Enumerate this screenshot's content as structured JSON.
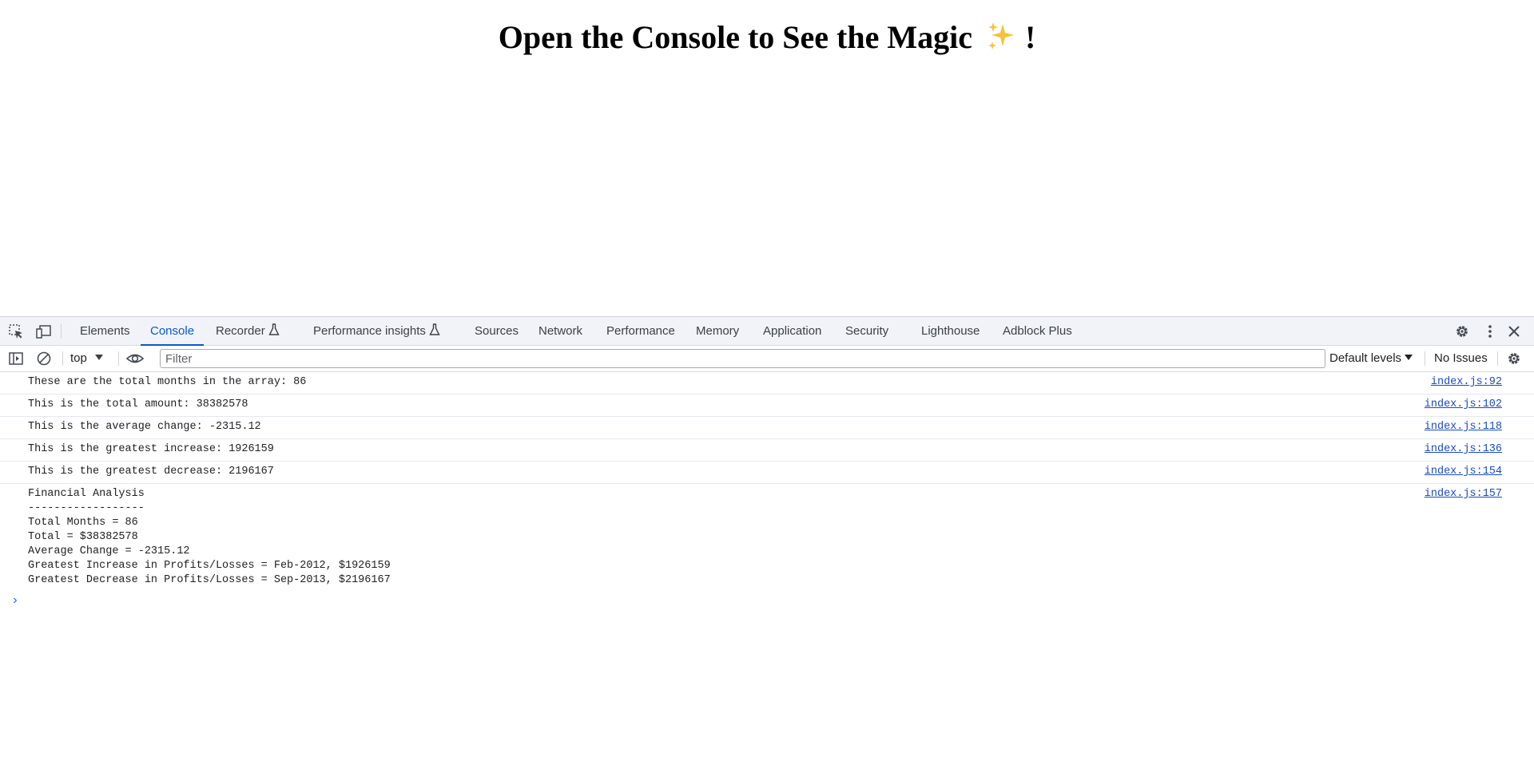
{
  "page": {
    "heading": "Open the Console to See the Magic",
    "heading_suffix": "!",
    "sparkle_icon": "sparkles-emoji"
  },
  "devtools": {
    "tabs": [
      {
        "label": "Elements",
        "active": false
      },
      {
        "label": "Console",
        "active": true
      },
      {
        "label": "Recorder",
        "active": false,
        "experimental": true
      },
      {
        "label": "Performance insights",
        "active": false,
        "experimental": true
      },
      {
        "label": "Sources",
        "active": false
      },
      {
        "label": "Network",
        "active": false
      },
      {
        "label": "Performance",
        "active": false
      },
      {
        "label": "Memory",
        "active": false
      },
      {
        "label": "Application",
        "active": false
      },
      {
        "label": "Security",
        "active": false
      },
      {
        "label": "Lighthouse",
        "active": false
      },
      {
        "label": "Adblock Plus",
        "active": false
      }
    ],
    "toolbar": {
      "context": "top",
      "filter_placeholder": "Filter",
      "levels": "Default levels",
      "issues": "No Issues"
    },
    "messages": [
      {
        "text": "These are the total months in the array: 86",
        "source": "index.js:92"
      },
      {
        "text": "This is the total amount: 38382578",
        "source": "index.js:102"
      },
      {
        "text": "This is the average change: -2315.12",
        "source": "index.js:118"
      },
      {
        "text": "This is the greatest increase: 1926159",
        "source": "index.js:136"
      },
      {
        "text": "This is the greatest decrease: 2196167",
        "source": "index.js:154"
      },
      {
        "text": "Financial Analysis\n------------------\nTotal Months = 86\nTotal = $38382578\nAverage Change = -2315.12\nGreatest Increase in Profits/Losses = Feb-2012, $1926159\nGreatest Decrease in Profits/Losses = Sep-2013, $2196167",
        "source": "index.js:157"
      }
    ],
    "prompt_symbol": "›"
  },
  "colors": {
    "accent": "#0b57d0",
    "link": "#1a4dbd",
    "tabbar_bg": "#f1f3f8"
  }
}
